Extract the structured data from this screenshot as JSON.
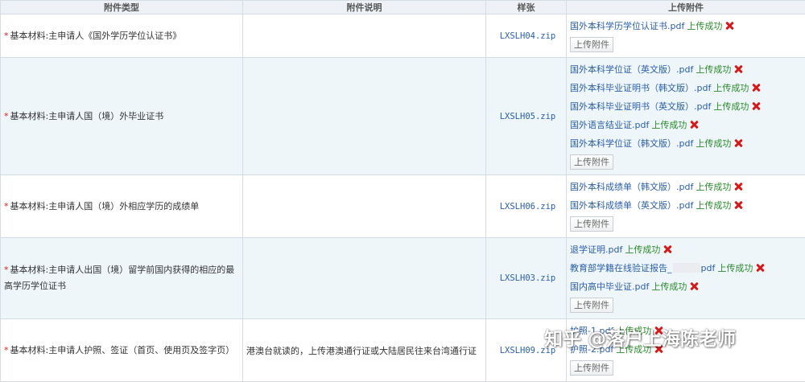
{
  "headers": [
    "附件类型",
    "附件说明",
    "样张",
    "上传附件"
  ],
  "upload_button_label": "上传附件",
  "success_label": "上传成功",
  "rows": [
    {
      "type": "基本材料:主申请人《国外学历学位认证书》",
      "desc": "",
      "sample": "LXSLH04.zip",
      "files": [
        "国外本科学历学位认证书.pdf"
      ]
    },
    {
      "type": "基本材料:主申请人国（境）外毕业证书",
      "desc": "",
      "sample": "LXSLH05.zip",
      "files": [
        "国外本科学位证（英文版）.pdf",
        "国外本科毕业证明书（韩文版）.pdf",
        "国外本科毕业证明书（英文版）.pdf",
        "国外语言结业证.pdf",
        "国外本科学位证（韩文版）.pdf"
      ]
    },
    {
      "type": "基本材料:主申请人国（境）外相应学历的成绩单",
      "desc": "",
      "sample": "LXSLH06.zip",
      "files": [
        "国外本科成绩单（韩文版）.pdf",
        "国外本科成绩单（英文版）.pdf"
      ]
    },
    {
      "type_line1": "基本材料:主申请人出国（境）留学前国内获得的相应的最",
      "type_line2": "高学历学位证书",
      "desc": "",
      "sample": "LXSLH03.zip",
      "files": [
        "退学证明.pdf",
        "教育部学籍在线验证报告_",
        "国内高中毕业证.pdf"
      ],
      "file2_suffix": "pdf"
    },
    {
      "type": "基本材料:主申请人护照、签证（首页、使用页及签字页）",
      "desc": "港澳台就读的，上传港澳通行证或大陆居民往来台湾通行证",
      "sample": "LXSLH09.zip",
      "files": [
        "护照-1.pdf",
        "护照-2.pdf"
      ]
    }
  ],
  "watermark": "知乎 @落户上海陈老师",
  "colors": {
    "header_bg": "#eef2f6",
    "alt_row_bg": "#eef6fa",
    "link": "#2a5ea8",
    "success": "#2b8a2b",
    "delete": "#d41b1b",
    "required": "#dd2222"
  }
}
